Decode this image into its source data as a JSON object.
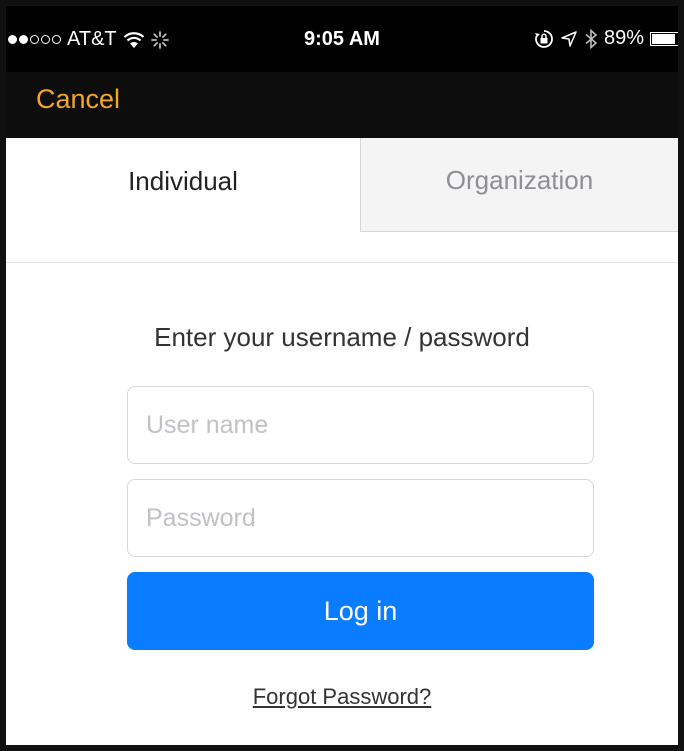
{
  "status_bar": {
    "signal_strength": 2,
    "signal_max": 5,
    "carrier": "AT&T",
    "time": "9:05 AM",
    "battery_percent": 89,
    "battery_label": "89%"
  },
  "nav": {
    "cancel_label": "Cancel",
    "cancel_color": "#f5a623"
  },
  "tabs": [
    {
      "label": "Individual",
      "selected": true
    },
    {
      "label": "Organization",
      "selected": false
    }
  ],
  "form": {
    "prompt": "Enter your username / password",
    "username": {
      "value": "",
      "placeholder": "User name"
    },
    "password": {
      "value": "",
      "placeholder": "Password"
    },
    "login_label": "Log in",
    "login_color": "#0a7cff",
    "forgot_label": "Forgot Password?"
  },
  "icons": [
    "wifi-icon",
    "activity-spinner-icon",
    "orientation-lock-icon",
    "location-arrow-icon",
    "bluetooth-icon",
    "battery-icon"
  ]
}
